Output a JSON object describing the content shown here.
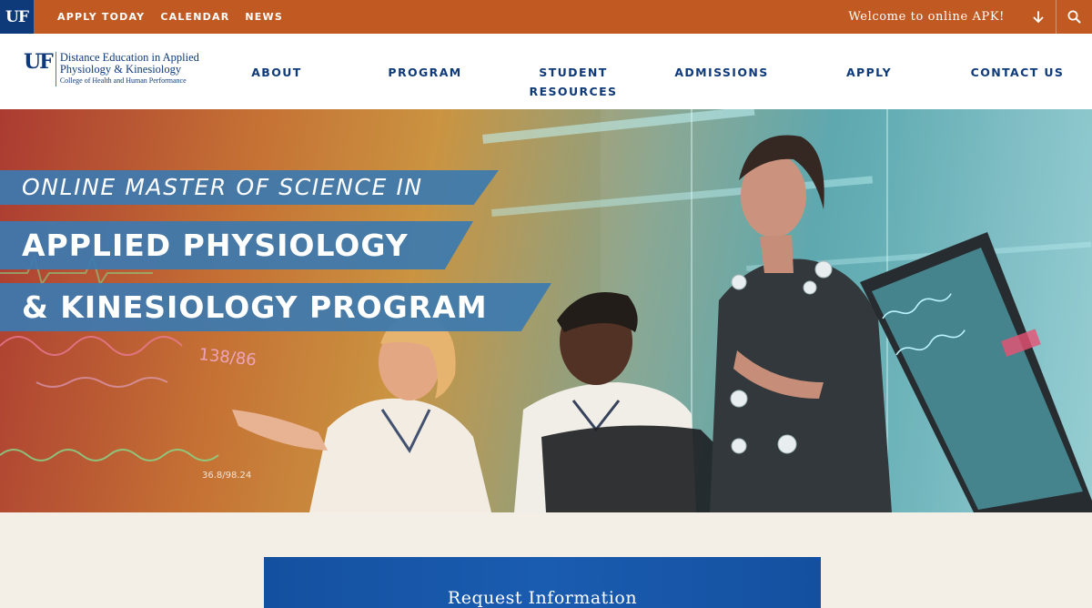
{
  "topbar": {
    "brand": "UF",
    "links": [
      "APPLY TODAY",
      "CALENDAR",
      "NEWS"
    ],
    "welcome": "Welcome to online APK!",
    "icons": {
      "arrow": "arrow-down-icon",
      "search": "search-icon"
    }
  },
  "header": {
    "logo": {
      "mark": "UF",
      "line1": "Distance Education in Applied",
      "line2": "Physiology & Kinesiology",
      "line3": "College of Health and Human Performance"
    },
    "nav": {
      "about": "ABOUT",
      "program": "PROGRAM",
      "student_resources_1": "STUDENT",
      "student_resources_2": "RESOURCES",
      "admissions": "ADMISSIONS",
      "apply": "APPLY",
      "contact": "CONTACT US"
    }
  },
  "hero": {
    "line1": "ONLINE MASTER OF SCIENCE IN",
    "line2": "APPLIED PHYSIOLOGY",
    "line3": "& KINESIOLOGY PROGRAM",
    "monitor_readout_1": "138/86",
    "monitor_readout_2": "36.8/98.24"
  },
  "cta": {
    "request_label": "Request Information"
  },
  "colors": {
    "topbar": "#c05a22",
    "brand_blue": "#0f3a7a",
    "banner_blue": "#3c7ab0",
    "cta_blue": "#1450a0",
    "page_bg": "#f3efe7"
  }
}
